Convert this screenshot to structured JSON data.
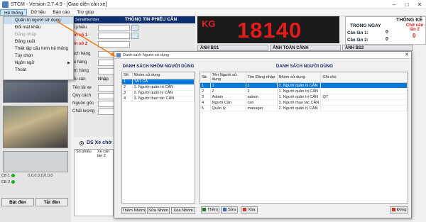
{
  "window": {
    "title": "STCM - Version 2.7.4.9 - [Giao diện cân xe]"
  },
  "menubar": {
    "items": [
      "Hệ thống",
      "Dữ liệu",
      "Báo cáo",
      "Trợ giúp"
    ]
  },
  "dropdown": {
    "items": [
      {
        "label": "Quản trị người sử dụng",
        "disabled": false
      },
      {
        "label": "Đổi mật khẩu",
        "disabled": false
      },
      {
        "label": "Đăng nhập",
        "disabled": true
      },
      {
        "label": "Đăng xuất",
        "disabled": false
      },
      {
        "label": "Thiết lập cấu hình hệ thống",
        "disabled": false
      },
      {
        "label": "Tùy chọn",
        "disabled": false
      },
      {
        "label": "Ngôn ngữ",
        "disabled": false
      },
      {
        "label": "Thoát",
        "disabled": false
      }
    ]
  },
  "ticket": {
    "header": "THÔNG TIN PHIẾU CÂN",
    "serial_label": "SerialNumber",
    "labels": [
      "ố phiếu",
      "ển số 1",
      "ển số 2",
      "ách hàng",
      "ại hàng",
      "ơn hàng",
      "ểu cân",
      "Tên lái xe",
      "Quy cách",
      "Nguồn gốc",
      "Chất lượng"
    ],
    "nhap_label": "Nhập"
  },
  "kg_display": {
    "unit": "KG",
    "value": "18140"
  },
  "stats": {
    "title": "THỐNG KÊ",
    "day_label": "TRONG NGAY",
    "can1_label": "Cân lần 1:",
    "can1_value": "0",
    "can2_label": "Cân lần 2:",
    "can2_value": "0",
    "waiting_label": "Chờ cân lần 2",
    "waiting_value": "0"
  },
  "image_headers": {
    "bs1": "ẢNH BS1",
    "toan_canh": "ẢNH TOÀN CẢNH",
    "bs2": "ẢNH BS2"
  },
  "left": {
    "cb1": "CB 1",
    "cb2": "CB 2",
    "values": "0,0,0,0,0,0,0,0",
    "barrier_on": "Bật đèn",
    "barrier_off": "Tắt đèn"
  },
  "ds": {
    "label": "DS Xe chờ",
    "col1": "Số phiếu",
    "col2": "Xe cân lần 2"
  },
  "modal": {
    "title": "Danh sách Người sử dụng",
    "groups_title": "DANH SÁCH NHÓM NGƯỜI DÙNG",
    "users_title": "DANH SÁCH NGƯỜI DÙNG",
    "group_columns": [
      "Stt",
      "Nhóm sử dụng"
    ],
    "groups": [
      [
        "1",
        "TẤT CẢ"
      ],
      [
        "2",
        "1. Người quản trị CÂN"
      ],
      [
        "3",
        "2. Người quản lý CÂN"
      ],
      [
        "4",
        "3. Người thao tác CÂN"
      ]
    ],
    "user_columns": [
      "Stt",
      "Tên Người sử dụng",
      "Tên Đăng nhập",
      "Nhóm sử dụng",
      "Ghi chú"
    ],
    "users": [
      [
        "1",
        "1",
        "1",
        "2. Người quản lý CÂN",
        ""
      ],
      [
        "2",
        "2",
        "2",
        "1. Người quản trị CÂN",
        ""
      ],
      [
        "3",
        "Admin",
        "admin",
        "1. Người quản trị CÂN",
        "QT"
      ],
      [
        "4",
        "Người Cân",
        "can",
        "3. Người thao tác CÂN",
        ""
      ],
      [
        "5",
        "Quản lý",
        "manager",
        "2. Người quản lý CÂN",
        ""
      ]
    ],
    "buttons": {
      "add_group": "Thêm Nhóm",
      "edit_group": "Sửa Nhóm",
      "delete_group": "Xóa Nhóm",
      "add": "Thêm",
      "edit": "Sửa",
      "delete": "Xóa",
      "close": "Đóng"
    }
  }
}
